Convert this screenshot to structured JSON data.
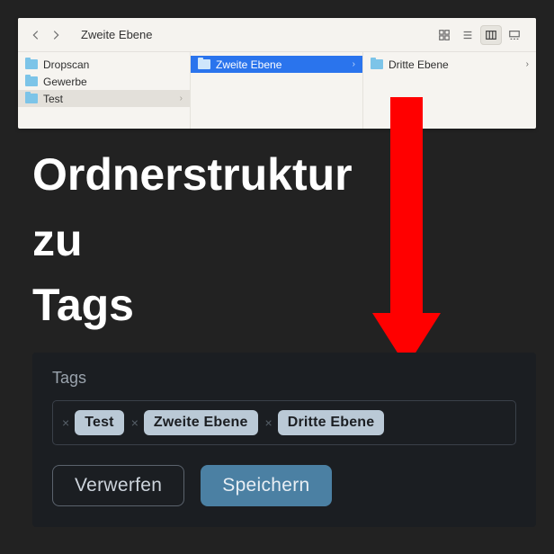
{
  "finder": {
    "breadcrumb": "Zweite Ebene",
    "columns": [
      {
        "items": [
          {
            "name": "Dropscan",
            "selected": false
          },
          {
            "name": "Gewerbe",
            "selected": false
          },
          {
            "name": "Test",
            "selected": true,
            "dim": true
          }
        ]
      },
      {
        "items": [
          {
            "name": "Zweite Ebene",
            "selected": true
          }
        ]
      },
      {
        "items": [
          {
            "name": "Dritte Ebene",
            "selected": false,
            "hasChildren": true
          }
        ]
      }
    ]
  },
  "headline": {
    "line1": "Ordnerstruktur",
    "line2": "zu",
    "line3": "Tags"
  },
  "tagsPanel": {
    "title": "Tags",
    "tags": [
      "Test",
      "Zweite Ebene",
      "Dritte Ebene"
    ],
    "cancel": "Verwerfen",
    "save": "Speichern"
  },
  "colors": {
    "arrow": "#ff0000"
  }
}
